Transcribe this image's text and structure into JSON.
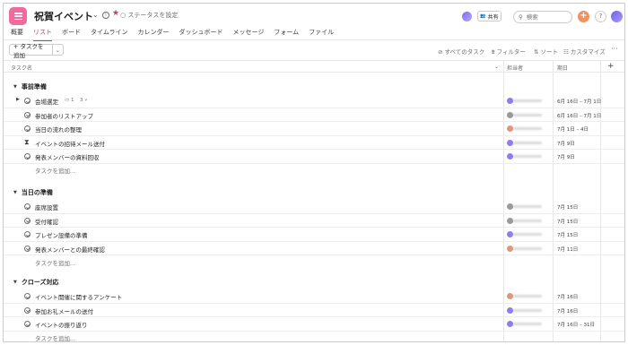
{
  "header": {
    "title": "祝賀イベント",
    "status_label": "ステータスを設定",
    "share_label": "共有",
    "search_placeholder": "検索",
    "plus_label": "+",
    "help_label": "?"
  },
  "tabs": [
    {
      "label": "概要",
      "active": false
    },
    {
      "label": "リスト",
      "active": true
    },
    {
      "label": "ボード",
      "active": false
    },
    {
      "label": "タイムライン",
      "active": false
    },
    {
      "label": "カレンダー",
      "active": false
    },
    {
      "label": "ダッシュボード",
      "active": false
    },
    {
      "label": "メッセージ",
      "active": false
    },
    {
      "label": "フォーム",
      "active": false
    },
    {
      "label": "ファイル",
      "active": false
    }
  ],
  "toolbar": {
    "add_task": "+ タスクを追加",
    "all_tasks": "すべてのタスク",
    "filter": "フィルター",
    "sort": "ソート",
    "customize": "カスタマイズ",
    "more": "···"
  },
  "columns": {
    "task_name": "タスク名",
    "assignee": "担当者",
    "due_date": "期日",
    "add": "+"
  },
  "sections": [
    {
      "title": "事前準備",
      "add_task": "タスクを追加...",
      "tasks": [
        {
          "name": "会場選定",
          "has_subtasks": true,
          "comments": "1",
          "subtasks": "3",
          "date": "6月 16日 – 7月 1日",
          "avatar_color": "#8d7ef0",
          "icon": "check"
        },
        {
          "name": "参加者のリストアップ",
          "date": "6月 16日 – 7月 1日",
          "avatar_color": "#9a9a9a",
          "icon": "check"
        },
        {
          "name": "当日の流れの整理",
          "date": "7月 1日 – 4日",
          "avatar_color": "#e0967a",
          "icon": "check"
        },
        {
          "name": "イベントの招待メール送付",
          "date": "7月 9日",
          "avatar_color": "#8d7ef0",
          "icon": "hourglass"
        },
        {
          "name": "発表メンバーの資料回収",
          "date": "7月 9日",
          "avatar_color": "#8d7ef0",
          "icon": "check"
        }
      ]
    },
    {
      "title": "当日の準備",
      "add_task": "タスクを追加...",
      "tasks": [
        {
          "name": "座席設置",
          "date": "7月 15日",
          "avatar_color": "#9a9a9a",
          "icon": "check"
        },
        {
          "name": "受付確認",
          "date": "7月 15日",
          "avatar_color": "#9a9a9a",
          "icon": "check"
        },
        {
          "name": "プレゼン設備の準備",
          "date": "7月 15日",
          "avatar_color": "#8d7ef0",
          "icon": "check"
        },
        {
          "name": "発表メンバーとの最終確認",
          "date": "7月 11日",
          "avatar_color": "#e0967a",
          "icon": "check"
        }
      ]
    },
    {
      "title": "クローズ対応",
      "add_task": "タスクを追加...",
      "tasks": [
        {
          "name": "イベント開催に関するアンケート",
          "date": "7月 16日",
          "avatar_color": "#e0967a",
          "icon": "check"
        },
        {
          "name": "参加お礼メールの送付",
          "date": "7月 16日",
          "avatar_color": "#8d7ef0",
          "icon": "check"
        },
        {
          "name": "イベントの振り返り",
          "date": "7月 16日 – 31日",
          "avatar_color": "#8d7ef0",
          "icon": "check"
        }
      ]
    }
  ]
}
